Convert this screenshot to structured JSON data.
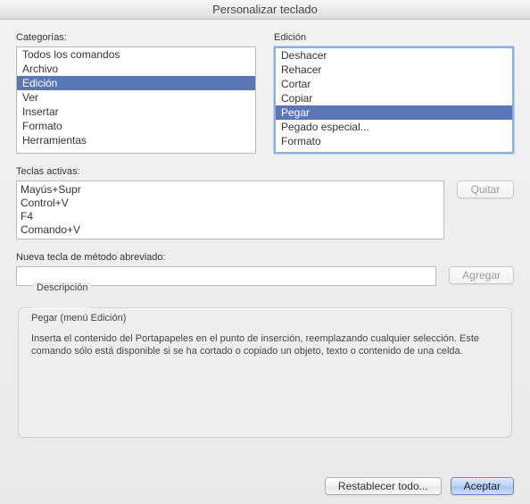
{
  "window": {
    "title": "Personalizar teclado"
  },
  "categories": {
    "label": "Categorías:",
    "items": [
      {
        "label": "Todos los comandos",
        "selected": false
      },
      {
        "label": "Archivo",
        "selected": false
      },
      {
        "label": "Edición",
        "selected": true
      },
      {
        "label": "Ver",
        "selected": false
      },
      {
        "label": "Insertar",
        "selected": false
      },
      {
        "label": "Formato",
        "selected": false
      },
      {
        "label": "Herramientas",
        "selected": false
      }
    ]
  },
  "commands": {
    "label": "Edición",
    "items": [
      {
        "label": "Deshacer",
        "selected": false
      },
      {
        "label": "Rehacer",
        "selected": false
      },
      {
        "label": "Cortar",
        "selected": false
      },
      {
        "label": "Copiar",
        "selected": false
      },
      {
        "label": "Pegar",
        "selected": true
      },
      {
        "label": "Pegado especial...",
        "selected": false
      },
      {
        "label": "Formato",
        "selected": false
      }
    ]
  },
  "active_keys": {
    "label": "Teclas activas:",
    "items": [
      "Mayús+Supr",
      "Control+V",
      "F4",
      "Comando+V"
    ],
    "remove_label": "Quitar"
  },
  "new_key": {
    "label": "Nueva tecla de método abreviado:",
    "value": "",
    "add_label": "Agregar"
  },
  "description": {
    "group_label": "Descripción",
    "title": "Pegar (menú Edición)",
    "text": "Inserta el contenido del Portapapeles en el punto de inserción, reemplazando cualquier selección. Este comando sólo está disponible si se ha cortado o copiado un objeto, texto o contenido de una celda."
  },
  "footer": {
    "reset_label": "Restablecer todo...",
    "accept_label": "Aceptar"
  }
}
